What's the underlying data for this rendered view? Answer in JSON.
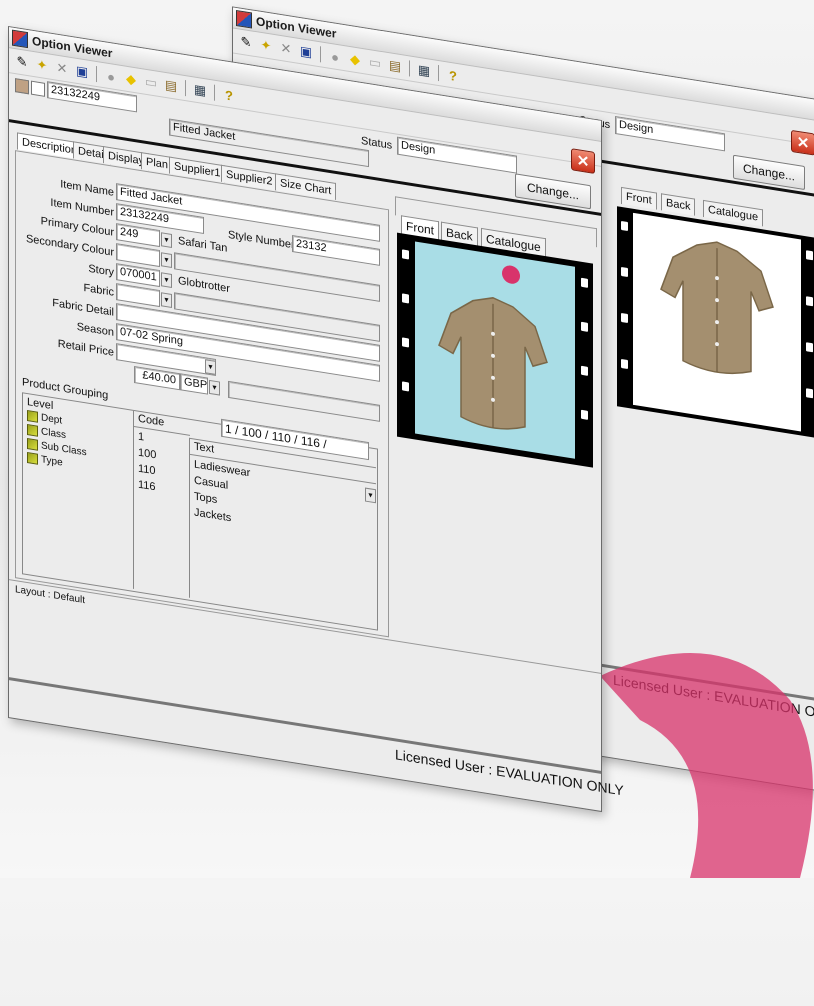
{
  "colors": {
    "accent_pink": "#d8336b",
    "film_bg": "#000000",
    "sky": "#a9dde6",
    "garment": "#a48f6f",
    "swatch": "#bfa184"
  },
  "window_title": "Option Viewer",
  "toolbar_icons": [
    "pencil-icon",
    "wand-icon",
    "x-icon",
    "save-icon",
    "circle-icon",
    "diamond-icon",
    "page-icon",
    "clipboard-icon",
    "grid-icon",
    "help-icon"
  ],
  "front": {
    "item_code": "23132249",
    "item_title": "Fitted Jacket",
    "status_label": "Status",
    "status_value": "Design",
    "change_label": "Change...",
    "tabs": [
      "Description",
      "Detail",
      "Display",
      "Plan",
      "Supplier1",
      "Supplier2",
      "Size Chart"
    ],
    "image_tabs": [
      "Front",
      "Back",
      "Catalogue"
    ],
    "labels": {
      "item_name": "Item Name",
      "item_number": "Item Number",
      "primary_colour": "Primary Colour",
      "secondary_colour": "Secondary Colour",
      "story": "Story",
      "fabric": "Fabric",
      "fabric_detail": "Fabric Detail",
      "season": "Season",
      "retail_price": "Retail Price",
      "style_number": "Style Number",
      "product_grouping": "Product Grouping"
    },
    "values": {
      "item_name": "Fitted Jacket",
      "item_number": "23132249",
      "primary_colour_code": "249",
      "primary_colour_name": "Safari Tan",
      "style_number": "23132",
      "story_code": "070001",
      "story_name": "Globtrotter",
      "season": "07-02 Spring",
      "retail_price": "£40.00",
      "currency": "GBP"
    },
    "grouping": {
      "headers": {
        "level": "Level",
        "code": "Code",
        "text": "Text"
      },
      "levels": [
        "Dept",
        "Class",
        "Sub Class",
        "Type"
      ],
      "codes": [
        "1",
        "100",
        "110",
        "116"
      ],
      "texts": [
        "Ladieswear",
        "Casual",
        "Tops",
        "Jackets"
      ],
      "path": "1 / 100 / 110 / 116 /"
    },
    "layout_label": "Layout : Default",
    "licensed": "Licensed User : EVALUATION ONLY"
  },
  "back": {
    "status_label": "Status",
    "status_value": "Design",
    "change_label": "Change...",
    "image_tabs": [
      "Front",
      "Back",
      "Catalogue"
    ],
    "licensed": "Licensed User : EVALUATION ONLY"
  }
}
